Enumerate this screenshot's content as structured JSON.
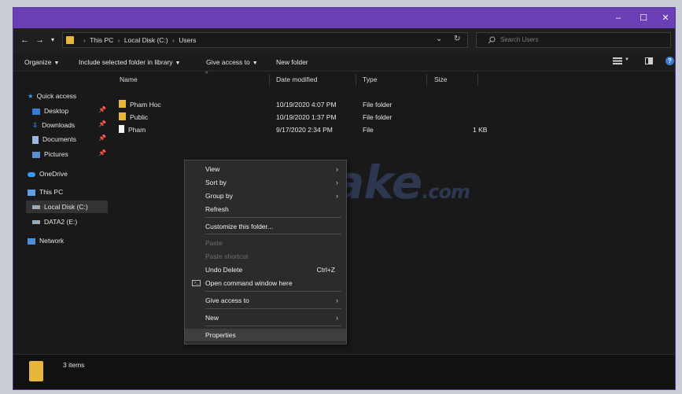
{
  "window": {
    "minimize": "–",
    "maximize": "☐",
    "close": "✕"
  },
  "address": {
    "back": "←",
    "forward": "→",
    "recent": "▾",
    "crumbs": [
      "This PC",
      "Local Disk (C:)",
      "Users"
    ],
    "dropdown": "⌄",
    "refresh": "↻",
    "search_placeholder": "Search Users"
  },
  "ribbon": {
    "organize": "Organize",
    "include_library": "Include selected folder in library",
    "give_access": "Give access to",
    "new_folder": "New folder",
    "help": "?"
  },
  "sidebar": {
    "quick_access": "Quick access",
    "items": [
      {
        "label": "Desktop",
        "pinned": true
      },
      {
        "label": "Downloads",
        "pinned": true
      },
      {
        "label": "Documents",
        "pinned": true
      },
      {
        "label": "Pictures",
        "pinned": true
      }
    ],
    "onedrive": "OneDrive",
    "this_pc": "This PC",
    "drives": [
      "Local Disk (C:)",
      "DATA2 (E:)"
    ],
    "network": "Network",
    "pin_glyph": "📌"
  },
  "columns": {
    "name": "Name",
    "date": "Date modified",
    "type": "Type",
    "size": "Size"
  },
  "files": [
    {
      "name": "Pham Hoc",
      "date": "10/19/2020 4:07 PM",
      "type": "File folder",
      "size": "",
      "kind": "folder"
    },
    {
      "name": "Public",
      "date": "10/19/2020 1:37 PM",
      "type": "File folder",
      "size": "",
      "kind": "folder"
    },
    {
      "name": "Pham",
      "date": "9/17/2020 2:34 PM",
      "type": "File",
      "size": "1 KB",
      "kind": "file"
    }
  ],
  "context_menu": {
    "view": "View",
    "sort_by": "Sort by",
    "group_by": "Group by",
    "refresh": "Refresh",
    "customize": "Customize this folder...",
    "paste": "Paste",
    "paste_shortcut": "Paste shortcut",
    "undo_delete": "Undo Delete",
    "undo_shortcut": "Ctrl+Z",
    "open_cmd": "Open command window here",
    "give_access": "Give access to",
    "new": "New",
    "properties": "Properties",
    "arrow": "›"
  },
  "status": {
    "count": "3 items"
  },
  "watermark": {
    "main": "TipsMake",
    "suffix": ".com"
  },
  "colors": {
    "titlebar": "#6b3fb5",
    "folder": "#e8b63a",
    "accent": "#3a7bd5"
  }
}
